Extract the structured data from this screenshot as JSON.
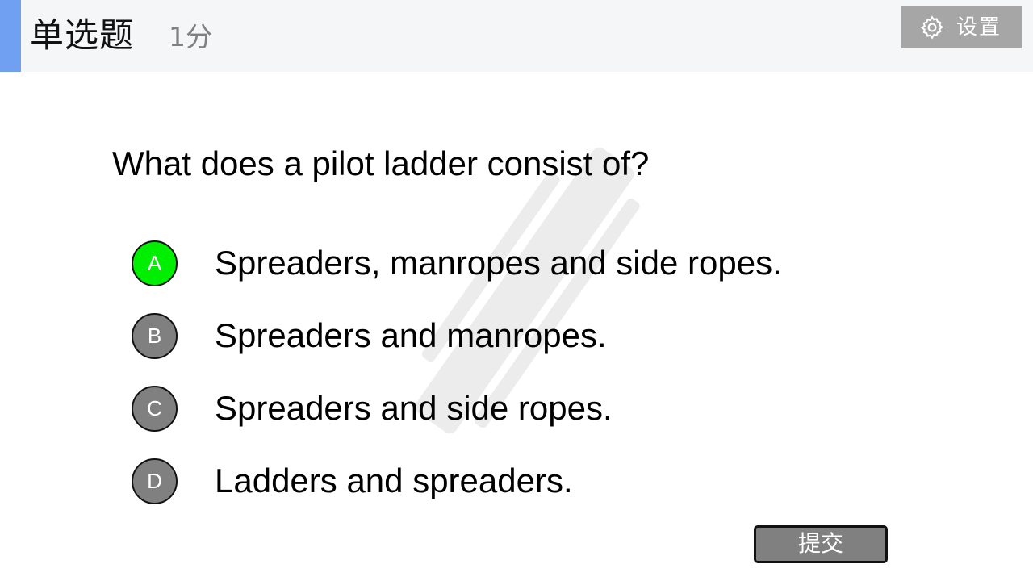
{
  "header": {
    "question_type": "单选题",
    "score": "1分",
    "settings_label": "设置",
    "settings_icon": "gear-icon",
    "accent_color": "#6fa0f2"
  },
  "question": {
    "text": "What does a pilot ladder consist of?"
  },
  "options": [
    {
      "letter": "A",
      "text": "Spreaders, manropes and side ropes.",
      "selected": true
    },
    {
      "letter": "B",
      "text": "Spreaders and manropes.",
      "selected": false
    },
    {
      "letter": "C",
      "text": "Spreaders and side ropes.",
      "selected": false
    },
    {
      "letter": "D",
      "text": "Ladders and spreaders.",
      "selected": false
    }
  ],
  "colors": {
    "selected": "#00ee00",
    "unselected": "#808080"
  },
  "footer": {
    "submit_label": "提交"
  }
}
